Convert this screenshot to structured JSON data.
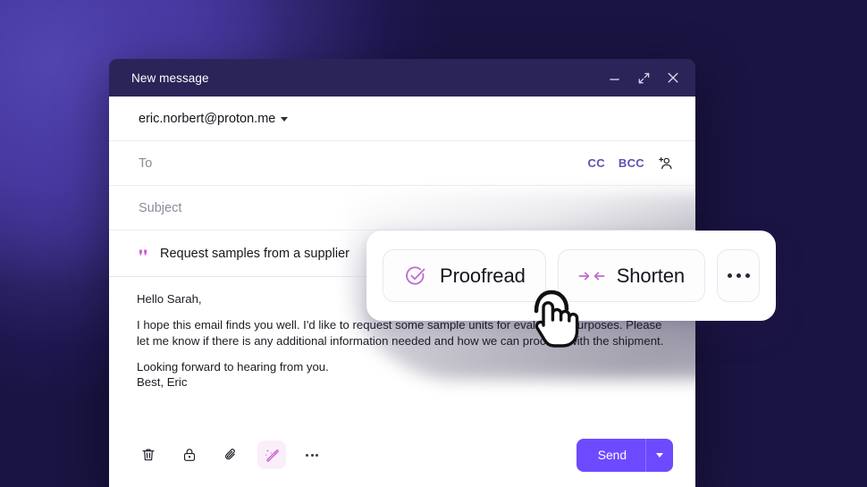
{
  "window": {
    "title": "New message",
    "controls": [
      {
        "name": "minimize",
        "icon": "minimize-icon"
      },
      {
        "name": "expand",
        "icon": "expand-icon"
      },
      {
        "name": "close",
        "icon": "close-icon"
      }
    ]
  },
  "form": {
    "from_address": "eric.norbert@proton.me",
    "to_placeholder": "To",
    "subject_placeholder": "Subject",
    "cc_label": "CC",
    "bcc_label": "BCC",
    "add_contact_icon": "add-contact-icon",
    "prompt_icon": "quote-sparkle-icon",
    "prompt_text": "Request samples from a supplier"
  },
  "message": {
    "greeting": "Hello Sarah,",
    "paragraph": "I hope this email finds you well. I'd like to request some sample units for evaluation purposes. Please let me know if there is any additional information needed and how we can proceed with the shipment.",
    "closing_line": "Looking forward to hearing from you.",
    "signature": "Best, Eric"
  },
  "toolbar": {
    "items": [
      {
        "name": "delete",
        "icon": "trash-icon"
      },
      {
        "name": "encrypt",
        "icon": "lock-icon"
      },
      {
        "name": "attach",
        "icon": "paperclip-icon"
      },
      {
        "name": "ai-assistant",
        "icon": "magic-wand-icon"
      },
      {
        "name": "more",
        "icon": "ellipsis-icon"
      }
    ],
    "send_label": "Send",
    "send_caret_icon": "chevron-down-icon"
  },
  "ai_popup": {
    "actions": [
      {
        "label": "Proofread",
        "icon": "check-circle-icon"
      },
      {
        "label": "Shorten",
        "icon": "compress-arrows-icon"
      }
    ],
    "more_icon": "ellipsis-icon"
  },
  "cursor": {
    "icon": "pointing-hand-cursor"
  },
  "colors": {
    "background_dark": "#1a1443",
    "background_glow": "#4b3ba0",
    "titlebar": "#2a2458",
    "accent_purple": "#6d4aff",
    "link_purple": "#5b51b4",
    "ai_pink": "#c95ad4",
    "ai_pill_bg": "#fbeefb"
  }
}
